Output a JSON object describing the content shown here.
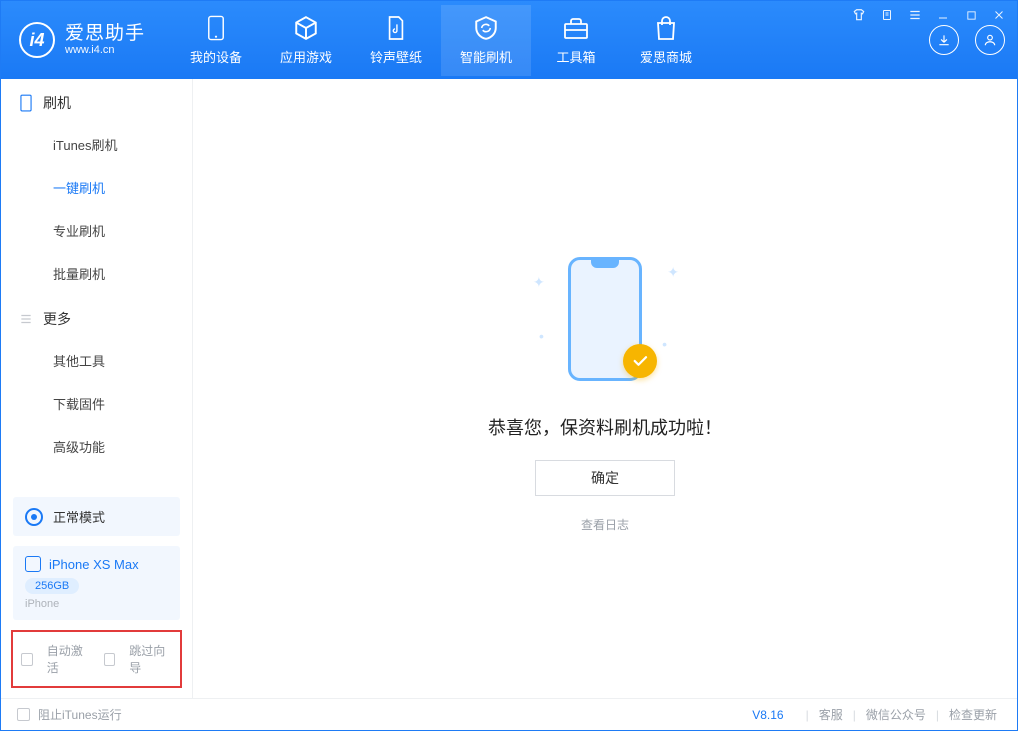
{
  "app": {
    "name_cn": "爱思助手",
    "url": "www.i4.cn"
  },
  "nav": [
    {
      "label": "我的设备"
    },
    {
      "label": "应用游戏"
    },
    {
      "label": "铃声壁纸"
    },
    {
      "label": "智能刷机"
    },
    {
      "label": "工具箱"
    },
    {
      "label": "爱思商城"
    }
  ],
  "sidebar": {
    "group1": {
      "title": "刷机",
      "items": [
        "iTunes刷机",
        "一键刷机",
        "专业刷机",
        "批量刷机"
      ]
    },
    "group2": {
      "title": "更多",
      "items": [
        "其他工具",
        "下载固件",
        "高级功能"
      ]
    }
  },
  "mode": {
    "label": "正常模式"
  },
  "device": {
    "name": "iPhone XS Max",
    "capacity": "256GB",
    "type": "iPhone"
  },
  "options": {
    "auto_activate": "自动激活",
    "skip_guide": "跳过向导"
  },
  "main": {
    "success_text": "恭喜您，保资料刷机成功啦！",
    "ok_btn": "确定",
    "view_log": "查看日志"
  },
  "status": {
    "block_itunes": "阻止iTunes运行",
    "version": "V8.16",
    "links": [
      "客服",
      "微信公众号",
      "检查更新"
    ]
  }
}
